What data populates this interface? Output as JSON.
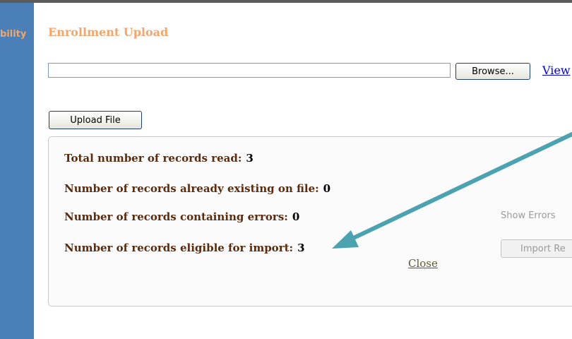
{
  "sidebar": {
    "label": "bility"
  },
  "panel": {
    "title": "Enrollment Upload"
  },
  "file_picker": {
    "value": "",
    "browse_label": "Browse...",
    "view_link": "View"
  },
  "upload_button_label": "Upload File",
  "results": {
    "rows": [
      {
        "label": "Total number of records read:",
        "value": "3"
      },
      {
        "label": "Number of records already existing on file:",
        "value": "0"
      },
      {
        "label": "Number of records containing errors:",
        "value": "0"
      },
      {
        "label": "Number of records eligible for import:",
        "value": "3"
      }
    ],
    "show_errors_label": "Show Errors",
    "import_button_label": "Import Re",
    "close_label": "Close"
  },
  "colors": {
    "sidebar_bg": "#4a7fb7",
    "title_orange": "#f3a56a",
    "label_brown": "#5a2b0d",
    "arrow_teal": "#4ba3b2"
  },
  "icons": {
    "annotation_arrow": "arrow-icon"
  }
}
